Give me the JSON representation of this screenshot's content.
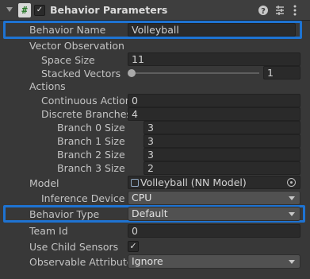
{
  "header": {
    "title": "Behavior Parameters",
    "icons": [
      "help-icon",
      "preset-icon",
      "more-options-icon"
    ],
    "script_icon": "#",
    "enabled": "✓"
  },
  "behavior_name": {
    "label": "Behavior Name",
    "value": "Volleyball"
  },
  "vector_observation": {
    "label": "Vector Observation",
    "space_size": {
      "label": "Space Size",
      "value": "11"
    },
    "stacked_vectors": {
      "label": "Stacked Vectors",
      "value": "1",
      "slider_fraction": 0.0
    }
  },
  "actions": {
    "label": "Actions",
    "continuous": {
      "label": "Continuous Actions",
      "value": "0"
    },
    "discrete": {
      "label": "Discrete Branches",
      "value": "4"
    },
    "branches": [
      {
        "label": "Branch 0 Size",
        "value": "3"
      },
      {
        "label": "Branch 1 Size",
        "value": "3"
      },
      {
        "label": "Branch 2 Size",
        "value": "3"
      },
      {
        "label": "Branch 3 Size",
        "value": "2"
      }
    ]
  },
  "model": {
    "label": "Model",
    "value": "Volleyball (NN Model)"
  },
  "inference_device": {
    "label": "Inference Device",
    "value": "CPU"
  },
  "behavior_type": {
    "label": "Behavior Type",
    "value": "Default"
  },
  "team_id": {
    "label": "Team Id",
    "value": "0"
  },
  "use_child_sensors": {
    "label": "Use Child Sensors",
    "checked": "✓"
  },
  "observable_attribute": {
    "label": "Observable Attribute H",
    "value": "Ignore"
  },
  "colors": {
    "highlight": "#1e73d2",
    "background": "#383838",
    "field": "#2a2a2a"
  }
}
